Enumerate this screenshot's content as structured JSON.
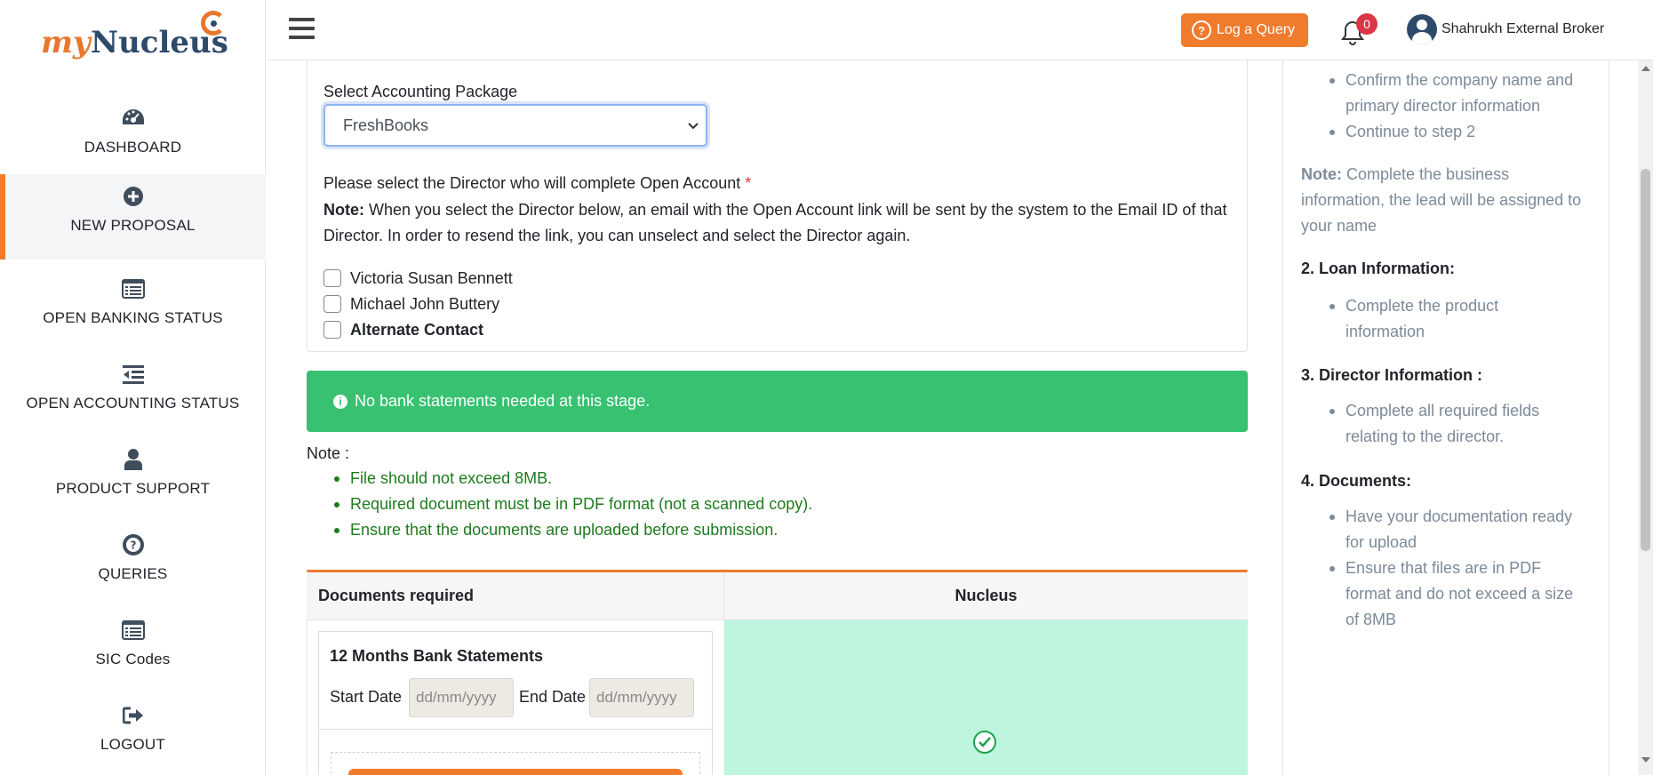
{
  "app": {
    "logo_my": "my",
    "logo_nucleus": "Nucleus"
  },
  "sidebar": {
    "items": [
      {
        "label": "DASHBOARD",
        "icon": "dashboard-gauge-icon"
      },
      {
        "label": "NEW PROPOSAL",
        "icon": "plus-circle-icon",
        "active": true
      },
      {
        "label": "OPEN BANKING STATUS",
        "icon": "list-alt-icon"
      },
      {
        "label": "OPEN ACCOUNTING STATUS",
        "icon": "outdent-list-icon"
      },
      {
        "label": "PRODUCT SUPPORT",
        "icon": "user-icon"
      },
      {
        "label": "QUERIES",
        "icon": "question-circle-icon"
      },
      {
        "label": "SIC Codes",
        "icon": "list-alt-icon"
      },
      {
        "label": "LOGOUT",
        "icon": "sign-out-icon"
      }
    ]
  },
  "header": {
    "log_query_label": "Log a Query",
    "notification_count": "0",
    "user_name": "Shahrukh External Broker"
  },
  "form": {
    "accounting_label": "Select Accounting Package",
    "accounting_value": "FreshBooks",
    "director_title": "Please select the Director who will complete Open Account",
    "required_mark": "*",
    "note_bold": "Note:",
    "note_text": " When you select the Director below, an email with the Open Account link will be sent by the system to the Email ID of that Director. In order to resend the link, you can unselect and select the Director again.",
    "directors": [
      {
        "name": "Victoria Susan Bennett",
        "checked": false
      },
      {
        "name": "Michael John Buttery",
        "checked": false
      },
      {
        "name": "Alternate Contact",
        "checked": false,
        "bold": true
      }
    ]
  },
  "alert": {
    "text": "No bank statements needed at this stage."
  },
  "upload_note": {
    "title": "Note :",
    "items": [
      "File should not exceed 8MB.",
      "Required document must be in PDF format (not a scanned copy).",
      "Ensure that the documents are uploaded before submission."
    ]
  },
  "documents": {
    "col1": "Documents required",
    "col2": "Nucleus",
    "bank_title": "12 Months Bank Statements",
    "start_label": "Start Date",
    "end_label": "End Date",
    "date_placeholder": "dd/mm/yyyy",
    "status_color": "#bdf5df"
  },
  "help": {
    "step1_items": [
      "Confirm the company name and primary director information",
      "Continue to step 2"
    ],
    "note_bold": "Note:",
    "note_text": " Complete the business information, the lead will be assigned to your name",
    "step2_title": "2. Loan Information:",
    "step2_items": [
      "Complete the product information"
    ],
    "step3_title": "3. Director Information :",
    "step3_items": [
      "Complete all required fields relating to the director."
    ],
    "step4_title": "4. Documents:",
    "step4_items": [
      "Have your documentation ready for upload",
      "Ensure that files are in PDF format and do not exceed a size of 8MB"
    ]
  },
  "colors": {
    "accent": "#ef7b2d",
    "success": "#37c171",
    "brand_dark": "#2e4a6a"
  }
}
